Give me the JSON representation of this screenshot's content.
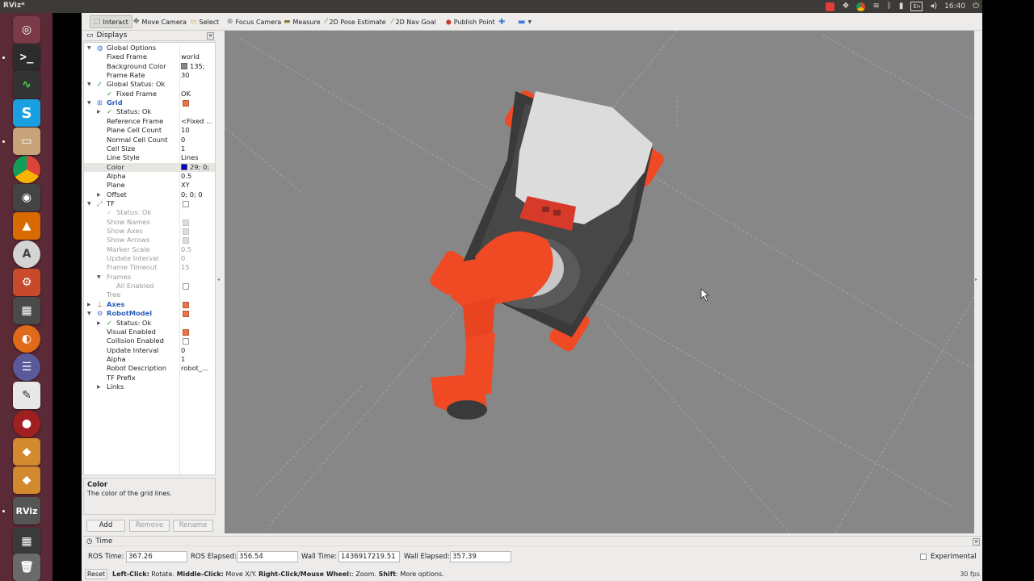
{
  "os": {
    "window_title": "RViz*",
    "language_indicator": "En",
    "clock": "16:40",
    "tray_icons": [
      "record-indicator-icon",
      "dropbox-icon",
      "chrome-icon",
      "wifi-icon",
      "bluetooth-icon",
      "battery-icon",
      "volume-icon",
      "power-icon"
    ],
    "launcher_icons": [
      "ubuntu-dash-icon",
      "terminal-icon",
      "system-monitor-icon",
      "skype-icon",
      "files-icon",
      "chrome-icon",
      "screen-recorder-icon",
      "vlc-icon",
      "software-center-icon",
      "system-settings-icon",
      "calculator-icon",
      "firefox-icon",
      "eclipse-icon",
      "text-editor-icon",
      "webcam-icon",
      "virtualbox-icon",
      "virtualbox-icon-2",
      "rviz-icon",
      "workspace-switcher-icon",
      "trash-icon"
    ]
  },
  "toolbar": {
    "tools": [
      {
        "label": "Interact",
        "icon": "interact-icon",
        "active": true
      },
      {
        "label": "Move Camera",
        "icon": "move-camera-icon",
        "active": false
      },
      {
        "label": "Select",
        "icon": "select-icon",
        "active": false
      },
      {
        "label": "Focus Camera",
        "icon": "focus-camera-icon",
        "active": false
      },
      {
        "label": "Measure",
        "icon": "measure-icon",
        "active": false
      },
      {
        "label": "2D Pose Estimate",
        "icon": "pose-estimate-icon",
        "active": false
      },
      {
        "label": "2D Nav Goal",
        "icon": "nav-goal-icon",
        "active": false
      },
      {
        "label": "Publish Point",
        "icon": "publish-point-icon",
        "active": false
      }
    ]
  },
  "displays": {
    "title": "Displays",
    "rows": [
      {
        "indent": 0,
        "expand": "down",
        "icon": "globe-icon",
        "label": "Global Options",
        "value": ""
      },
      {
        "indent": 1,
        "label": "Fixed Frame",
        "value": "world"
      },
      {
        "indent": 1,
        "label": "Background Color",
        "value": "135;",
        "swatch": "#878787"
      },
      {
        "indent": 1,
        "label": "Frame Rate",
        "value": "30"
      },
      {
        "indent": 0,
        "expand": "down",
        "ok": true,
        "label": "Global Status: Ok",
        "value": ""
      },
      {
        "indent": 1,
        "ok": true,
        "label": "Fixed Frame",
        "value": "OK"
      },
      {
        "indent": 0,
        "expand": "down",
        "icon": "grid-icon",
        "label": "Grid",
        "blue": true,
        "check": true
      },
      {
        "indent": 1,
        "expand": "right",
        "ok": true,
        "label": "Status: Ok",
        "value": ""
      },
      {
        "indent": 1,
        "label": "Reference Frame",
        "value": "<Fixed ..."
      },
      {
        "indent": 1,
        "label": "Plane Cell Count",
        "value": "10"
      },
      {
        "indent": 1,
        "label": "Normal Cell Count",
        "value": "0"
      },
      {
        "indent": 1,
        "label": "Cell Size",
        "value": "1"
      },
      {
        "indent": 1,
        "label": "Line Style",
        "value": "Lines"
      },
      {
        "indent": 1,
        "label": "Color",
        "value": "29; 0;",
        "swatch": "#0000c8",
        "selected": true
      },
      {
        "indent": 1,
        "label": "Alpha",
        "value": "0.5"
      },
      {
        "indent": 1,
        "label": "Plane",
        "value": "XY"
      },
      {
        "indent": 1,
        "expand": "right",
        "label": "Offset",
        "value": "0; 0; 0"
      },
      {
        "indent": 0,
        "expand": "down",
        "icon": "tf-icon",
        "label": "TF",
        "check": false
      },
      {
        "indent": 1,
        "ok": true,
        "label": "Status: Ok",
        "value": "",
        "disabled": true
      },
      {
        "indent": 1,
        "label": "Show Names",
        "check": true,
        "disabled": true
      },
      {
        "indent": 1,
        "label": "Show Axes",
        "check": true,
        "disabled": true
      },
      {
        "indent": 1,
        "label": "Show Arrows",
        "check": true,
        "disabled": true
      },
      {
        "indent": 1,
        "label": "Marker Scale",
        "value": "0.5",
        "disabled": true
      },
      {
        "indent": 1,
        "label": "Update Interval",
        "value": "0",
        "disabled": true
      },
      {
        "indent": 1,
        "label": "Frame Timeout",
        "value": "15",
        "disabled": true
      },
      {
        "indent": 1,
        "expand": "down",
        "label": "Frames",
        "value": "",
        "disabled": true
      },
      {
        "indent": 2,
        "label": "All Enabled",
        "check": false,
        "disabled": true
      },
      {
        "indent": 1,
        "label": "Tree",
        "value": "",
        "disabled": true
      },
      {
        "indent": 0,
        "expand": "right",
        "icon": "axes-icon",
        "label": "Axes",
        "blue": true,
        "check": true
      },
      {
        "indent": 0,
        "expand": "down",
        "icon": "robot-model-icon",
        "label": "RobotModel",
        "blue": true,
        "check": true
      },
      {
        "indent": 1,
        "expand": "right",
        "ok": true,
        "label": "Status: Ok",
        "value": ""
      },
      {
        "indent": 1,
        "label": "Visual Enabled",
        "check": true
      },
      {
        "indent": 1,
        "label": "Collision Enabled",
        "check": false
      },
      {
        "indent": 1,
        "label": "Update Interval",
        "value": "0"
      },
      {
        "indent": 1,
        "label": "Alpha",
        "value": "1"
      },
      {
        "indent": 1,
        "label": "Robot Description",
        "value": "robot_..."
      },
      {
        "indent": 1,
        "label": "TF Prefix",
        "value": ""
      },
      {
        "indent": 1,
        "expand": "right",
        "label": "Links",
        "value": ""
      }
    ],
    "description_title": "Color",
    "description_text": "The color of the grid lines.",
    "add_label": "Add",
    "remove_label": "Remove",
    "rename_label": "Rename"
  },
  "time": {
    "title": "Time",
    "ros_time_label": "ROS Time:",
    "ros_time": "367.26",
    "ros_elapsed_label": "ROS Elapsed:",
    "ros_elapsed": "356.54",
    "wall_time_label": "Wall Time:",
    "wall_time": "1436917219.51",
    "wall_elapsed_label": "Wall Elapsed:",
    "wall_elapsed": "357.39",
    "experimental_label": "Experimental"
  },
  "status": {
    "reset_label": "Reset",
    "help_1b": "Left-Click:",
    "help_1": " Rotate. ",
    "help_2b": "Middle-Click:",
    "help_2": " Move X/Y. ",
    "help_3b": "Right-Click/Mouse Wheel:",
    "help_3": ": Zoom. ",
    "help_4b": "Shift",
    "help_4": ": More options.",
    "fps": "30 fps"
  },
  "colors": {
    "robot_orange": "#f04a24",
    "robot_dark": "#3a3a3a",
    "robot_plate": "#d8d8d8",
    "grid_line": "#9aa3c2",
    "viewport_bg": "#878787",
    "launcher_bg": "#5a2a36"
  }
}
